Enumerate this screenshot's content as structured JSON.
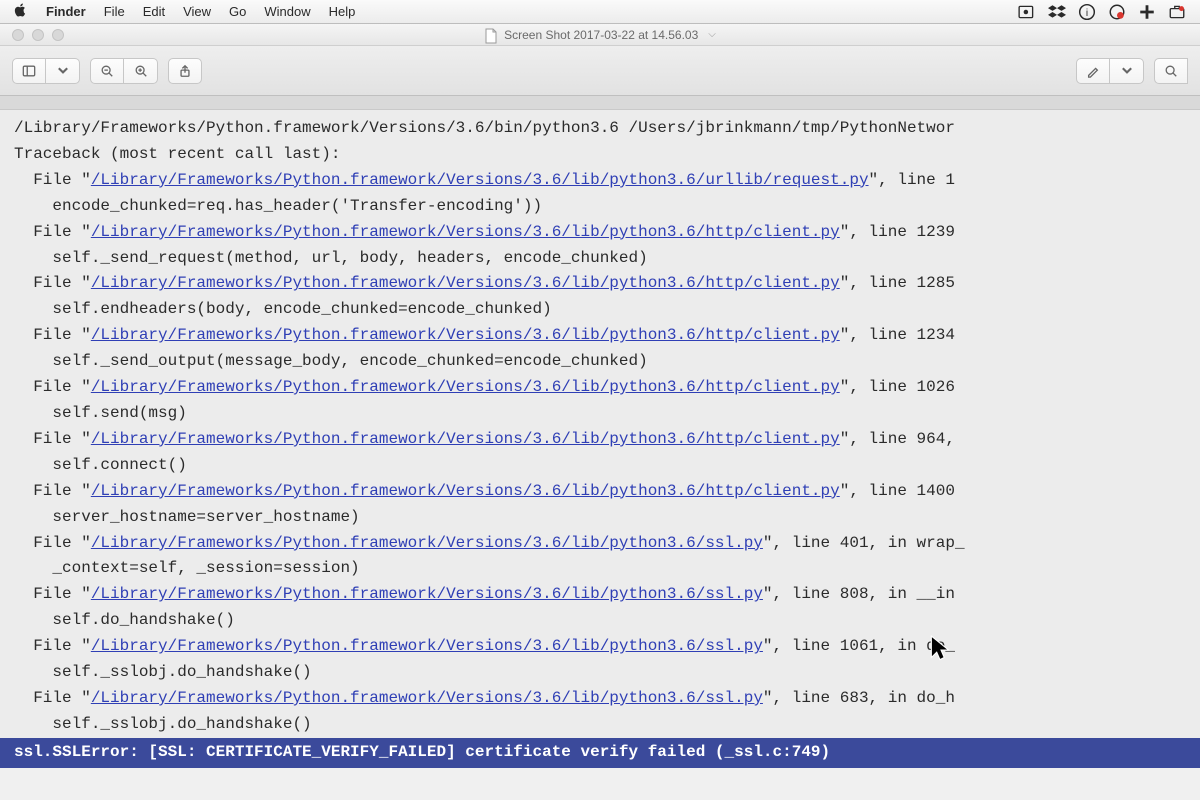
{
  "menubar": {
    "app": "Finder",
    "items": [
      "File",
      "Edit",
      "View",
      "Go",
      "Window",
      "Help"
    ]
  },
  "window": {
    "title": "Screen Shot 2017-03-22 at 14.56.03"
  },
  "traceback": {
    "cmd": "/Library/Frameworks/Python.framework/Versions/3.6/bin/python3.6 /Users/jbrinkmann/tmp/PythonNetwor",
    "header": "Traceback (most recent call last):",
    "frames": [
      {
        "path": "/Library/Frameworks/Python.framework/Versions/3.6/lib/python3.6/urllib/request.py",
        "line": "1",
        "code": "encode_chunked=req.has_header('Transfer-encoding'))"
      },
      {
        "path": "/Library/Frameworks/Python.framework/Versions/3.6/lib/python3.6/http/client.py",
        "line": "1239",
        "code": "self._send_request(method, url, body, headers, encode_chunked)"
      },
      {
        "path": "/Library/Frameworks/Python.framework/Versions/3.6/lib/python3.6/http/client.py",
        "line": "1285",
        "code": "self.endheaders(body, encode_chunked=encode_chunked)"
      },
      {
        "path": "/Library/Frameworks/Python.framework/Versions/3.6/lib/python3.6/http/client.py",
        "line": "1234",
        "code": "self._send_output(message_body, encode_chunked=encode_chunked)"
      },
      {
        "path": "/Library/Frameworks/Python.framework/Versions/3.6/lib/python3.6/http/client.py",
        "line": "1026",
        "code": "self.send(msg)"
      },
      {
        "path": "/Library/Frameworks/Python.framework/Versions/3.6/lib/python3.6/http/client.py",
        "line": "964,",
        "code": "self.connect()"
      },
      {
        "path": "/Library/Frameworks/Python.framework/Versions/3.6/lib/python3.6/http/client.py",
        "line": "1400",
        "code": "server_hostname=server_hostname)"
      },
      {
        "path": "/Library/Frameworks/Python.framework/Versions/3.6/lib/python3.6/ssl.py",
        "line": "401, in wrap_",
        "code": "_context=self, _session=session)"
      },
      {
        "path": "/Library/Frameworks/Python.framework/Versions/3.6/lib/python3.6/ssl.py",
        "line": "808, in __in",
        "code": "self.do_handshake()"
      },
      {
        "path": "/Library/Frameworks/Python.framework/Versions/3.6/lib/python3.6/ssl.py",
        "line": "1061, in do_",
        "code": "self._sslobj.do_handshake()"
      },
      {
        "path": "/Library/Frameworks/Python.framework/Versions/3.6/lib/python3.6/ssl.py",
        "line": "683, in do_h",
        "code": "self._sslobj.do_handshake()"
      }
    ],
    "error": "ssl.SSLError: [SSL: CERTIFICATE_VERIFY_FAILED] certificate verify failed (_ssl.c:749)"
  }
}
